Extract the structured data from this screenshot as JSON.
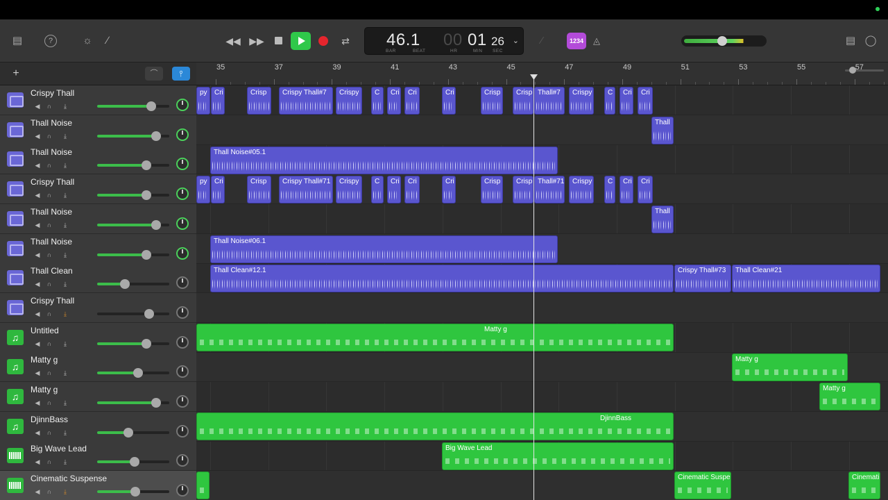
{
  "transport": {
    "bar_beat": "46.1",
    "bar_label": "BAR",
    "beat_label": "BEAT",
    "hr": "00",
    "hr_label": "HR",
    "min": "01",
    "min_label": "MIN",
    "sec": "26",
    "sec_label": "SEC",
    "count_in": "1234"
  },
  "ruler": {
    "bars": [
      "35",
      "37",
      "39",
      "41",
      "43",
      "45",
      "47",
      "49",
      "51",
      "53",
      "55",
      "57"
    ]
  },
  "tracks": [
    {
      "name": "Crispy Thall",
      "type": "audio",
      "volume": 0.75,
      "pan_lit": true
    },
    {
      "name": "Thall Noise",
      "type": "audio",
      "volume": 0.82,
      "pan_lit": true
    },
    {
      "name": "Thall Noise",
      "type": "audio",
      "volume": 0.68,
      "pan_lit": true
    },
    {
      "name": "Crispy Thall",
      "type": "audio",
      "volume": 0.68,
      "pan_lit": true
    },
    {
      "name": "Thall Noise",
      "type": "audio",
      "volume": 0.82,
      "pan_lit": true
    },
    {
      "name": "Thall Noise",
      "type": "audio",
      "volume": 0.68,
      "pan_lit": true
    },
    {
      "name": "Thall Clean",
      "type": "audio",
      "volume": 0.38,
      "pan_lit": false
    },
    {
      "name": "Crispy Thall",
      "type": "audio",
      "volume": 0.72,
      "pan_lit": false
    },
    {
      "name": "Untitled",
      "type": "midi",
      "volume": 0.68,
      "pan_lit": false
    },
    {
      "name": "Matty g",
      "type": "midi",
      "volume": 0.57,
      "pan_lit": false
    },
    {
      "name": "Matty g",
      "type": "midi",
      "volume": 0.82,
      "pan_lit": false
    },
    {
      "name": "DjinnBass",
      "type": "midi",
      "volume": 0.43,
      "pan_lit": false
    },
    {
      "name": "Big Wave Lead",
      "type": "keys",
      "volume": 0.52,
      "pan_lit": false
    },
    {
      "name": "Cinematic Suspense",
      "type": "keys",
      "volume": 0.53,
      "pan_lit": false
    }
  ],
  "regions": {
    "crispy_row": [
      "py",
      "Cri",
      "Crisp",
      "Crispy Thall#7",
      "Crispy",
      "C",
      "Cri",
      "Cri",
      "Cri",
      "Crisp",
      "Crisp",
      "Thall#7",
      "Crispy",
      "C",
      "Cri",
      "Cri"
    ],
    "crispy_row_b": [
      "py",
      "Cri",
      "Crisp",
      "Crispy Thall#71",
      "Crispy",
      "C",
      "Cri",
      "Cri",
      "Cri",
      "Crisp",
      "Crisp",
      "Thall#71",
      "Crispy",
      "C",
      "Cri",
      "Cri"
    ],
    "thall_short": "Thall",
    "thall_noise_05": "Thall Noise#05.1",
    "thall_noise_06": "Thall Noise#06.1",
    "thall_clean_12": "Thall Clean#12.1",
    "crispy_73": "Crispy Thall#73",
    "thall_clean_21": "Thall Clean#21",
    "matty_g": "Matty g",
    "djinnbass": "DjinnBass",
    "big_wave_lead": "Big Wave Lead",
    "cinematic_suspense": "Cinematic Suspe",
    "cinematic_short": "Cinemati"
  }
}
